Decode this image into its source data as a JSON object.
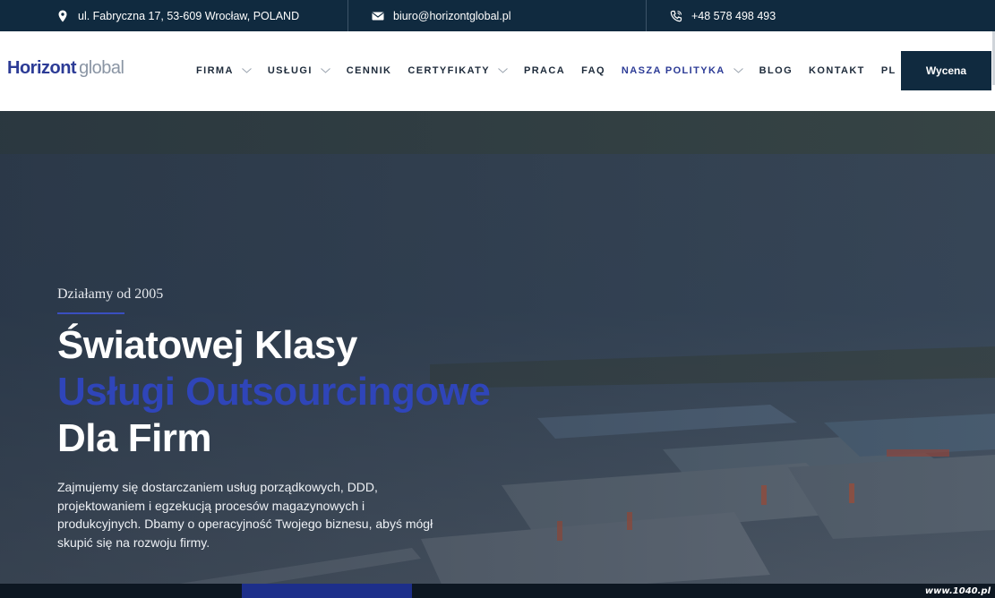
{
  "topbar": {
    "address": "ul. Fabryczna 17, 53-609 Wrocław, POLAND",
    "email": "biuro@horizontglobal.pl",
    "phone": "+48 578 498 493",
    "icons": [
      "location-pin-icon",
      "envelope-icon",
      "phone-icon"
    ]
  },
  "brand": {
    "name_bold": "Horizont",
    "name_light": "global"
  },
  "nav": {
    "items": [
      {
        "label": "FIRMA",
        "dropdown": true
      },
      {
        "label": "USŁUGI",
        "dropdown": true
      },
      {
        "label": "CENNIK",
        "dropdown": false
      },
      {
        "label": "CERTYFIKATY",
        "dropdown": true
      },
      {
        "label": "PRACA",
        "dropdown": false
      },
      {
        "label": "FAQ",
        "dropdown": false
      },
      {
        "label": "NASZA POLITYKA",
        "dropdown": true,
        "active": true
      },
      {
        "label": "BLOG",
        "dropdown": false
      },
      {
        "label": "KONTAKT",
        "dropdown": false
      },
      {
        "label": "PL",
        "dropdown": true
      }
    ],
    "cta_label": "Wycena"
  },
  "hero": {
    "eyebrow": "Działamy od 2005",
    "title_line1": "Światowej Klasy",
    "title_line2": "Usługi Outsourcingowe",
    "title_line3": "Dla Firm",
    "lead": "Zajmujemy się dostarczaniem usług porządkowych, DDD, projektowaniem i egzekucją procesów magazynowych i produkcyjnych. Dbamy o operacyjność Twojego biznesu, abyś mógł skupić się na rozwoju firmy."
  },
  "watermark": "www.1040.pl",
  "colors": {
    "navy": "#102a3f",
    "brand_blue": "#2c3b96",
    "accent_blue": "#2f45b9",
    "white": "#ffffff"
  }
}
